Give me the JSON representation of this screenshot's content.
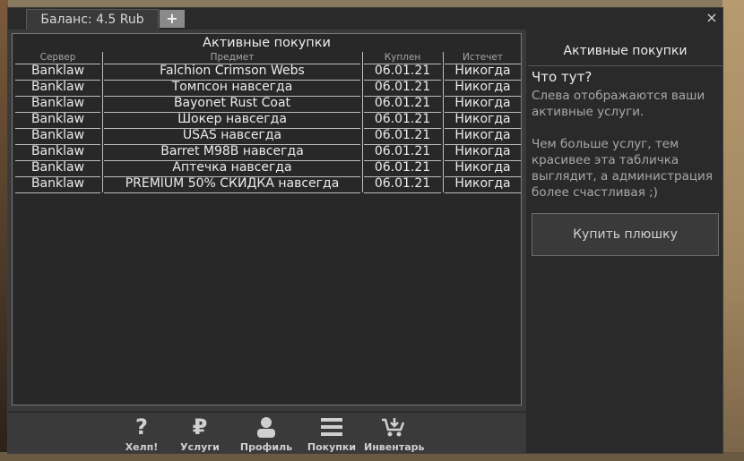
{
  "tabs": {
    "balance_label": "Баланс: 4.5 Rub",
    "add_label": "+"
  },
  "window": {
    "close_label": "×"
  },
  "purchases": {
    "title": "Активные покупки",
    "columns": [
      "Сервер",
      "Предмет",
      "Куплен",
      "Истечет"
    ],
    "rows": [
      [
        "Banklaw",
        "Falchion Crimson Webs",
        "06.01.21",
        "Никогда"
      ],
      [
        "Banklaw",
        "Томпсон навсегда",
        "06.01.21",
        "Никогда"
      ],
      [
        "Banklaw",
        "Bayonet Rust Coat",
        "06.01.21",
        "Никогда"
      ],
      [
        "Banklaw",
        "Шокер навсегда",
        "06.01.21",
        "Никогда"
      ],
      [
        "Banklaw",
        "USAS навсегда",
        "06.01.21",
        "Никогда"
      ],
      [
        "Banklaw",
        "Barret M98B навсегда",
        "06.01.21",
        "Никогда"
      ],
      [
        "Banklaw",
        "Аптечка навсегда",
        "06.01.21",
        "Никогда"
      ],
      [
        "Banklaw",
        "PREMIUM 50% СКИДКА навсегда",
        "06.01.21",
        "Никогда"
      ]
    ]
  },
  "nav": [
    {
      "label": "Хелп!",
      "icon": "question-icon",
      "glyph": "?"
    },
    {
      "label": "Услуги",
      "icon": "ruble-icon",
      "glyph": "₽"
    },
    {
      "label": "Профиль",
      "icon": "user-icon"
    },
    {
      "label": "Покупки",
      "icon": "menu-icon"
    },
    {
      "label": "Инвентарь",
      "icon": "cart-icon"
    }
  ],
  "info": {
    "title": "Активные покупки",
    "heading": "Что тут?",
    "paragraphs": [
      "Слева отображаются ваши активные услуги.",
      "Чем больше услуг, тем красивее эта табличка выглядит, а администрация более счастливая ;)"
    ],
    "button_label": "Купить плюшку"
  }
}
